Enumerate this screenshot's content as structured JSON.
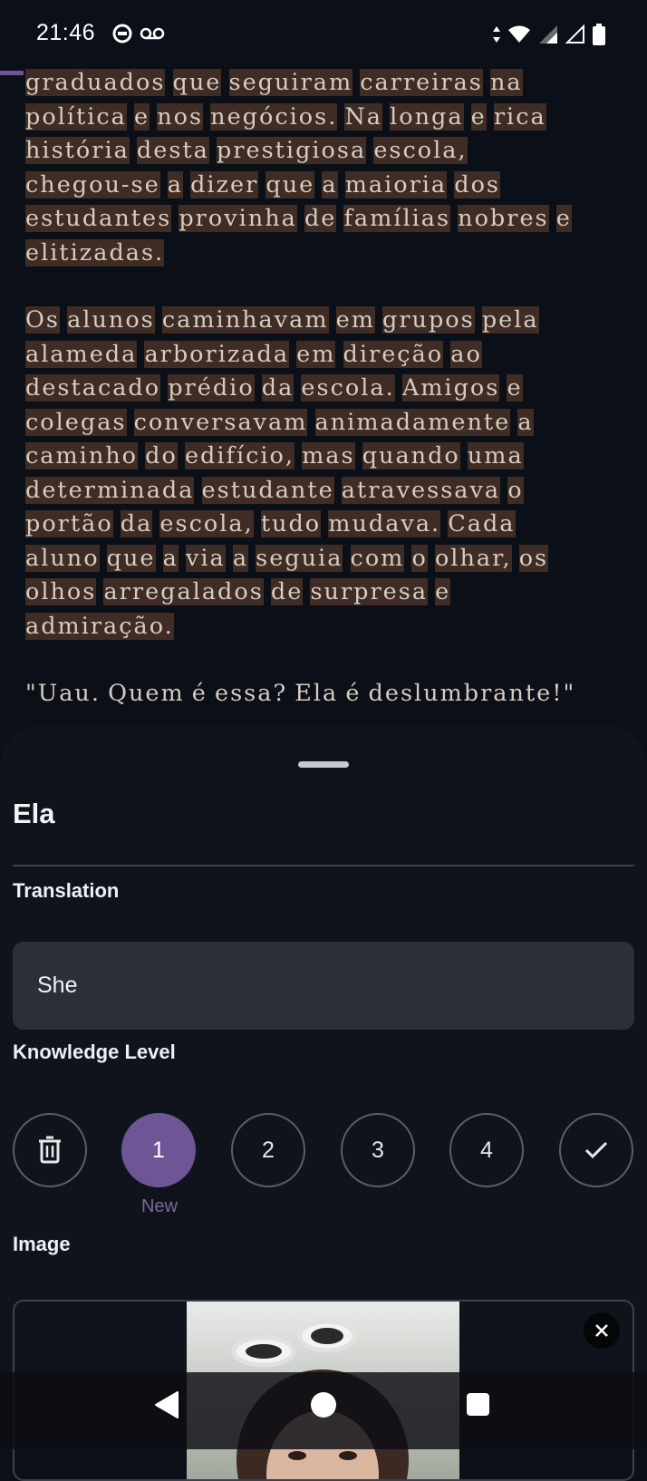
{
  "status_bar": {
    "time": "21:46",
    "left_icons": [
      "ring-icon",
      "voicemail-icon"
    ],
    "right_icons": [
      "data-arrows-icon",
      "wifi-icon",
      "signal-icon",
      "signal-empty-icon",
      "battery-icon"
    ]
  },
  "reader": {
    "paragraphs": [
      [
        [
          "graduados",
          "que",
          "seguiram",
          "carreiras",
          "na"
        ],
        [
          "política",
          "e",
          "nos",
          "negócios.",
          "Na",
          "longa",
          "e",
          "rica"
        ],
        [
          "história",
          "desta",
          "prestigiosa",
          "escola,"
        ],
        [
          "chegou-se",
          "a",
          "dizer",
          "que",
          "a",
          "maioria",
          "dos"
        ],
        [
          "estudantes",
          "provinha",
          "de",
          "famílias",
          "nobres",
          "e"
        ],
        [
          "elitizadas."
        ]
      ],
      [
        [
          "Os",
          "alunos",
          "caminhavam",
          "em",
          "grupos",
          "pela"
        ],
        [
          "alameda",
          "arborizada",
          "em",
          "direção",
          "ao"
        ],
        [
          "destacado",
          "prédio",
          "da",
          "escola.",
          "Amigos",
          "e"
        ],
        [
          "colegas",
          "conversavam",
          "animadamente",
          "a"
        ],
        [
          "caminho",
          "do",
          "edifício,",
          "mas",
          "quando",
          "uma"
        ],
        [
          "determinada",
          "estudante",
          "atravessava",
          "o"
        ],
        [
          "portão",
          "da",
          "escola,",
          "tudo",
          "mudava.",
          "Cada"
        ],
        [
          "aluno",
          "que",
          "a",
          "via",
          "a",
          "seguia",
          "com",
          "o",
          "olhar,",
          "os"
        ],
        [
          "olhos",
          "arregalados",
          "de",
          "surpresa",
          "e"
        ],
        [
          "admiração."
        ]
      ],
      [
        [
          "\"Uau.",
          "Quem",
          "é",
          "essa?",
          "Ela",
          "é",
          "deslumbrante!\""
        ]
      ]
    ],
    "known_words": [
      "\"Uau.",
      "Quem",
      "é",
      "essa?",
      "Ela",
      "deslumbrante!\""
    ]
  },
  "sheet": {
    "word": "Ela",
    "translation_label": "Translation",
    "translation_value": "She",
    "knowledge_label": "Knowledge Level",
    "levels": [
      {
        "label": "",
        "icon": "trash-icon",
        "active": false
      },
      {
        "label": "1",
        "active": true
      },
      {
        "label": "2",
        "active": false
      },
      {
        "label": "3",
        "active": false
      },
      {
        "label": "4",
        "active": false
      },
      {
        "label": "",
        "icon": "check-icon",
        "active": false
      }
    ],
    "level_caption": "New",
    "image_label": "Image"
  },
  "colors": {
    "accent": "#6e5596",
    "highlight": "#3e2c25",
    "text_serif": "#d7ccc0",
    "background": "#0b0f17"
  }
}
